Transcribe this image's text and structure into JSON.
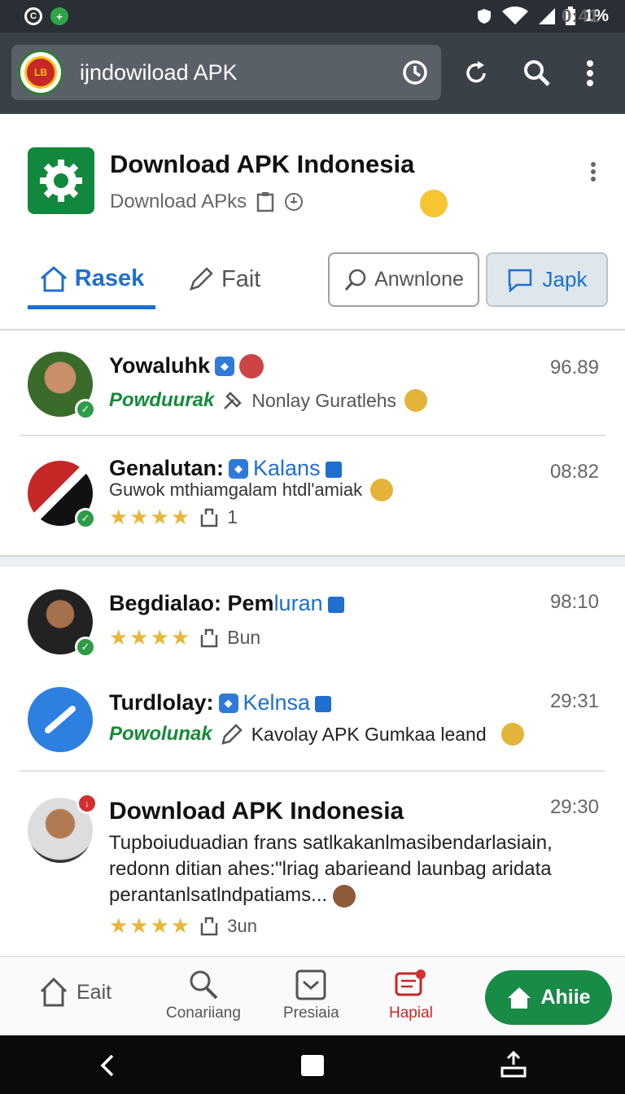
{
  "status_bar": {
    "time": "0:41",
    "battery": "1%"
  },
  "browser": {
    "url": "ijndowiload APK"
  },
  "app": {
    "title": "Download APK Indonesia",
    "subtitle": "Download APks"
  },
  "tabs": [
    {
      "label": "Rasek",
      "active": true
    },
    {
      "label": "Fait",
      "active": false
    }
  ],
  "buttons": {
    "search_label": "Anwnlone",
    "action_label": "Japk"
  },
  "items": [
    {
      "name": "Yowaluhk",
      "time": "96.89",
      "brand": "Powduurak",
      "detail": "Nonlay Guratlehs"
    },
    {
      "name": "Genalutan:",
      "tag": "Kalans",
      "time": "08:82",
      "desc": "Guwok mthiamgalam htdl'amiak",
      "count": "1"
    },
    {
      "name": "Begdialao: Pem",
      "tag": "luran",
      "time": "98:10",
      "count": "Bun"
    },
    {
      "name": "Turdlolay:",
      "tag": "Kelnsa",
      "time": "29:31",
      "brand": "Powolunak",
      "detail": "Kavolay APK Gumkaa leand"
    },
    {
      "name": "Download APK Indonesia",
      "time": "29:30",
      "body": "Tupboiuduadian frans satlkakanlmasibendarlasiain, redonn ditian ahes:\"lriag abarieand launbag aridata perantanlsatlndpatiams...",
      "count": "3un"
    }
  ],
  "bottom_nav": [
    {
      "label": "Eait"
    },
    {
      "label": "Conariiang"
    },
    {
      "label": "Presiaia"
    },
    {
      "label": "Hapial"
    },
    {
      "label": "Ahiie"
    }
  ],
  "colors": {
    "accent": "#1e6fcf",
    "brand_green": "#168a3a",
    "fab": "#188b46",
    "star": "#e8b63a",
    "alert": "#d32f2f"
  }
}
